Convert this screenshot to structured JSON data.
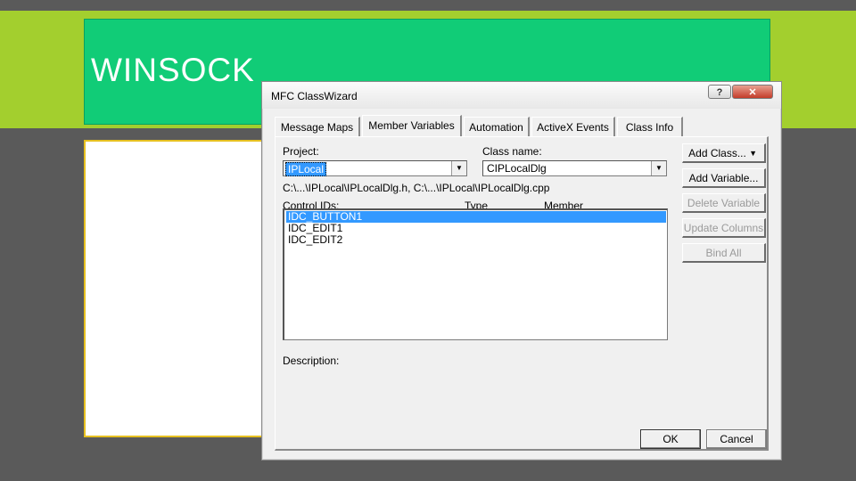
{
  "slide": {
    "title": "WINSOCK"
  },
  "dialog": {
    "title": "MFC ClassWizard",
    "help_label": "?",
    "close_label": "✕",
    "tabs": [
      "Message Maps",
      "Member Variables",
      "Automation",
      "ActiveX Events",
      "Class Info"
    ],
    "active_tab": "Member Variables",
    "project_label": "Project:",
    "project_value": "IPLocal",
    "class_label": "Class name:",
    "class_value": "CIPLocalDlg",
    "files_text": "C:\\...\\IPLocal\\IPLocalDlg.h, C:\\...\\IPLocal\\IPLocalDlg.cpp",
    "columns": {
      "control_ids": "Control IDs:",
      "type": "Type",
      "member": "Member"
    },
    "control_ids": [
      "IDC_BUTTON1",
      "IDC_EDIT1",
      "IDC_EDIT2"
    ],
    "description_label": "Description:",
    "buttons": {
      "add_class": "Add Class...",
      "add_variable": "Add Variable...",
      "delete_variable": "Delete Variable",
      "update_columns": "Update Columns",
      "bind_all": "Bind All"
    },
    "ok_label": "OK",
    "cancel_label": "Cancel",
    "colors": {
      "selection": "#3399ff",
      "title_green": "#11cc77",
      "band_green": "#a3cf2e"
    },
    "icons": {
      "dropdown": "chevron-down-icon"
    }
  }
}
